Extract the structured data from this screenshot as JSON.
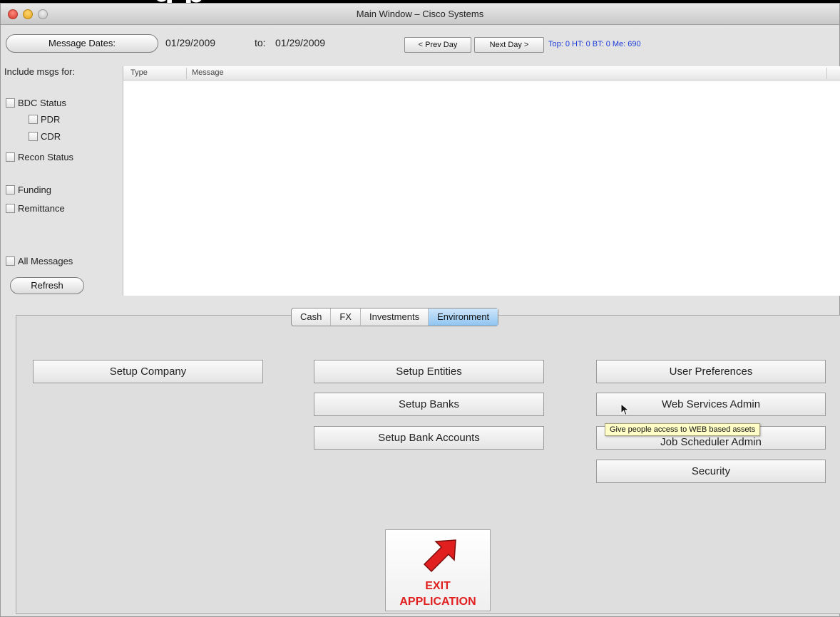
{
  "header_crop_text": "g p",
  "window": {
    "title": "Main Window – Cisco Systems"
  },
  "toolbar": {
    "message_dates_button": "Message Dates:",
    "date_from": "01/29/2009",
    "to_label": "to:",
    "date_to": "01/29/2009",
    "prev_day": "< Prev Day",
    "next_day": "Next Day >",
    "stats": "Top: 0  HT: 0 BT: 0 Me: 690"
  },
  "filters": {
    "include_label": "Include msgs for:",
    "bdc_status": "BDC Status",
    "pdr": "PDR",
    "cdr": "CDR",
    "recon_status": "Recon Status",
    "funding": "Funding",
    "remittance": "Remittance",
    "all_messages": "All Messages",
    "refresh": "Refresh"
  },
  "table": {
    "col_type": "Type",
    "col_message": "Message",
    "rows": []
  },
  "tabs": [
    {
      "label": "Cash",
      "active": false
    },
    {
      "label": "FX",
      "active": false
    },
    {
      "label": "Investments",
      "active": false
    },
    {
      "label": "Environment",
      "active": true
    }
  ],
  "buttons": {
    "setup_company": "Setup Company",
    "setup_entities": "Setup Entities",
    "setup_banks": "Setup Banks",
    "setup_bank_accounts": "Setup Bank Accounts",
    "user_preferences": "User Preferences",
    "web_services_admin": "Web Services Admin",
    "job_scheduler_admin": "Job Scheduler Admin",
    "security": "Security"
  },
  "tooltip": "Give people access to WEB based assets",
  "exit": {
    "line1": "EXIT",
    "line2": "APPLICATION"
  },
  "colors": {
    "accent_blue": "#1d3cd8",
    "tab_active": "#8fc4f1",
    "exit_red": "#e11f1f",
    "tooltip_bg": "#fffec6"
  }
}
